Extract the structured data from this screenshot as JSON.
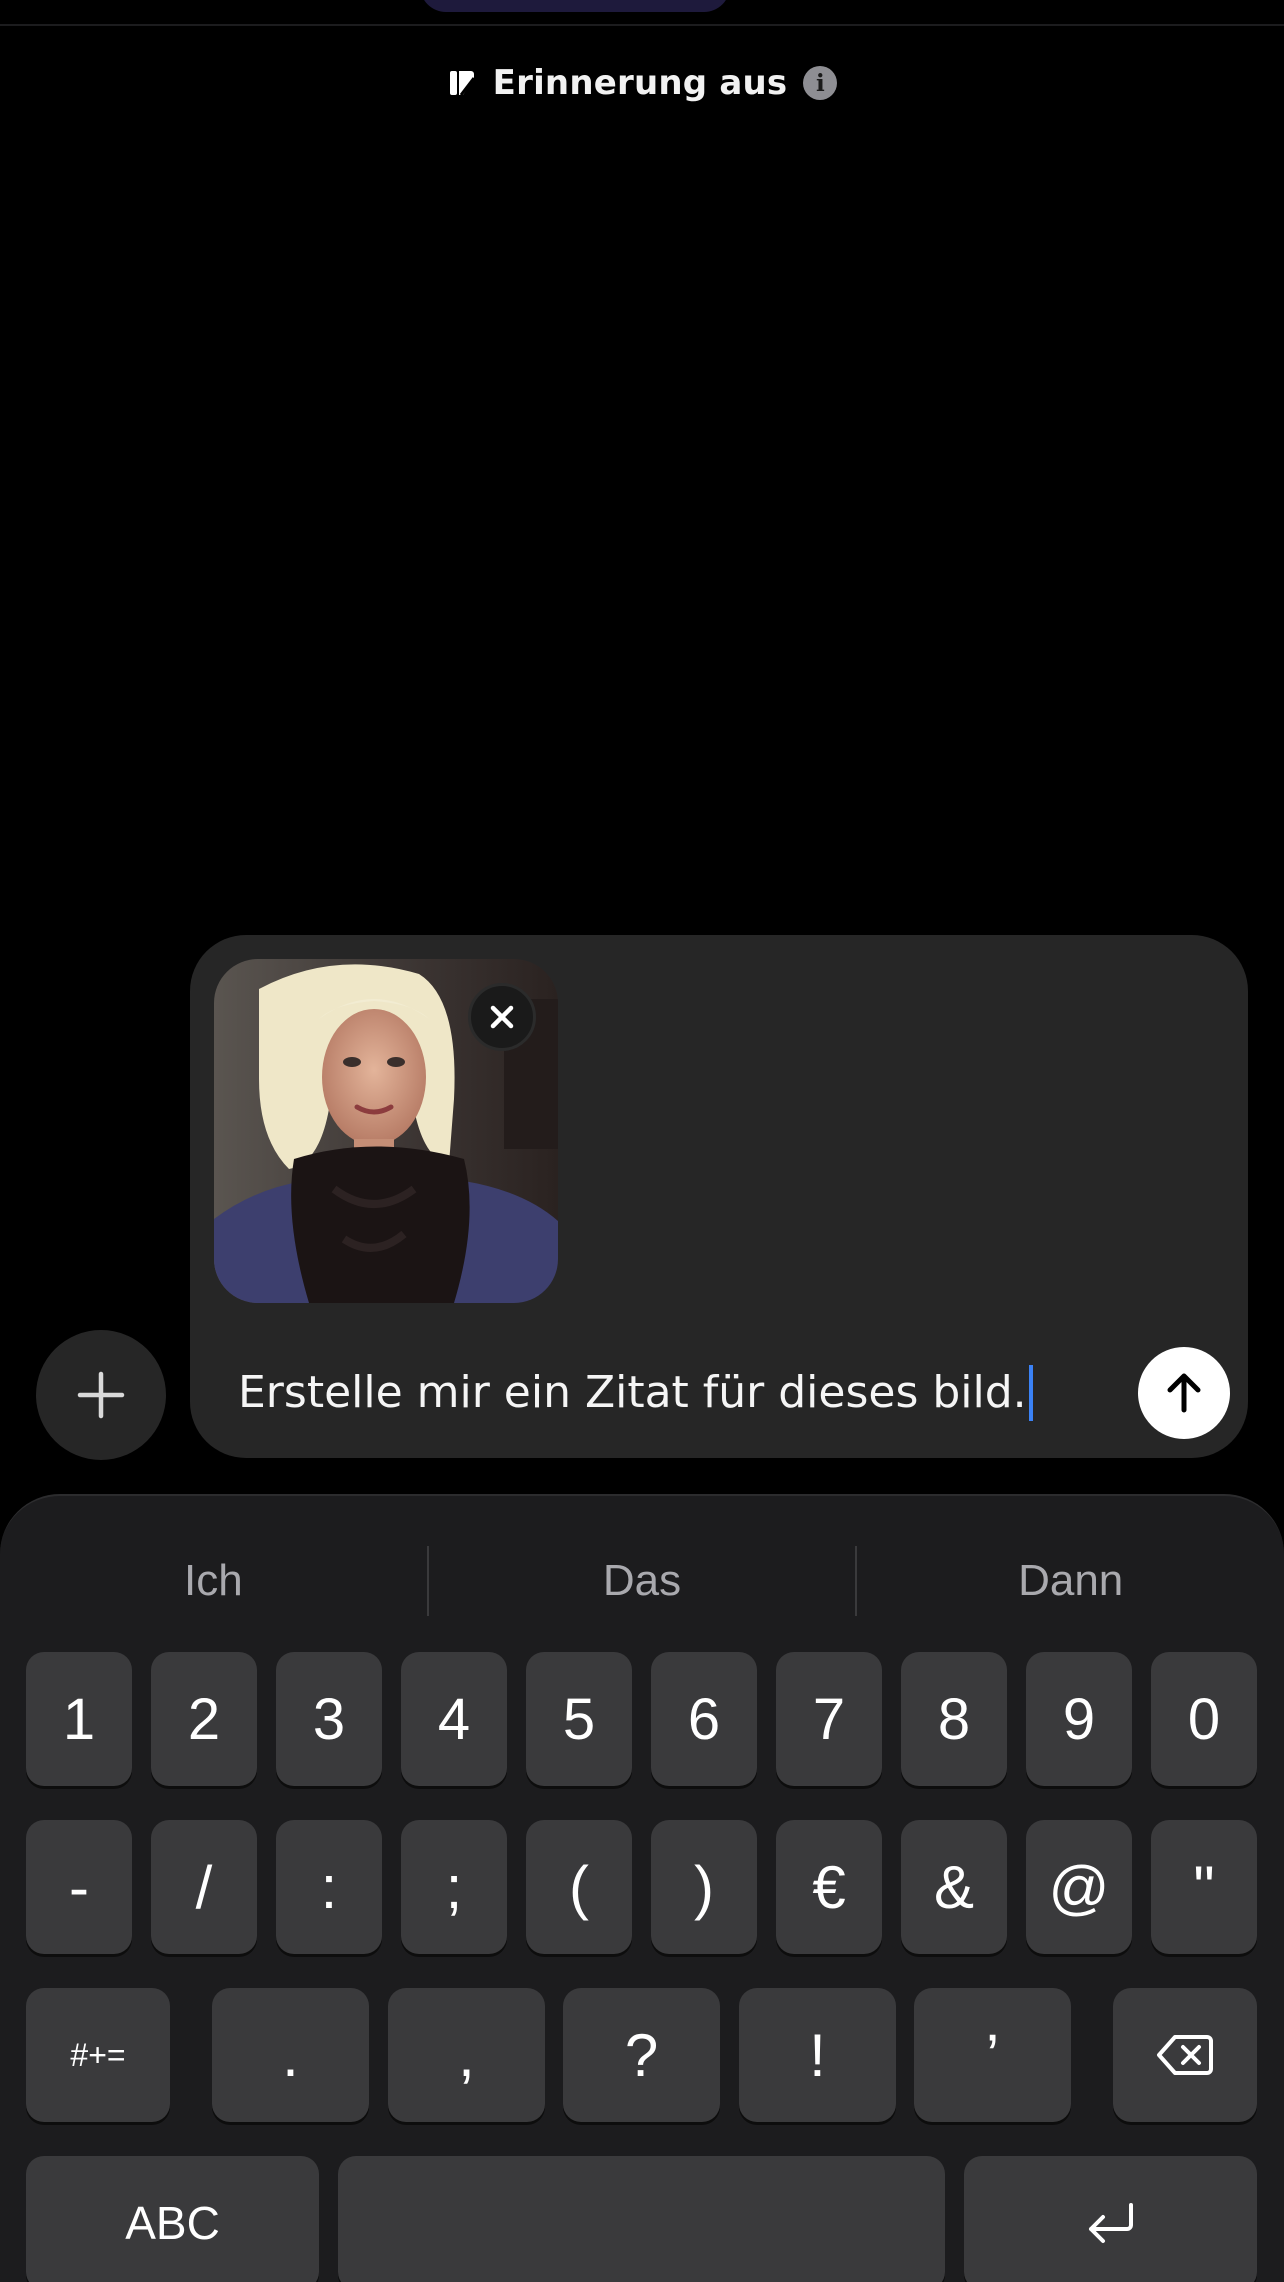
{
  "memory": {
    "label": "Erinnerung aus"
  },
  "composer": {
    "text": "Erstelle mir ein Zitat für dieses bild.",
    "attachment_icon": "image-thumbnail",
    "remove_icon": "close-icon",
    "send_icon": "arrow-up-icon"
  },
  "plus": {
    "icon": "plus-icon"
  },
  "keyboard": {
    "suggestions": [
      "Ich",
      "Das",
      "Dann"
    ],
    "row1": [
      "1",
      "2",
      "3",
      "4",
      "5",
      "6",
      "7",
      "8",
      "9",
      "0"
    ],
    "row2": [
      "-",
      "/",
      ":",
      ";",
      "(",
      ")",
      "€",
      "&",
      "@",
      "\""
    ],
    "row3": {
      "mode": "#+=",
      "keys": [
        ".",
        ",",
        "?",
        "!",
        "’"
      ]
    },
    "row4": {
      "abc": "ABC",
      "space": "",
      "return_icon": "return-icon"
    }
  },
  "colors": {
    "caret": "#3b82f6",
    "composer_bg": "#262626",
    "key_bg": "#3a3a3c",
    "keyboard_bg": "#1c1c1e"
  }
}
